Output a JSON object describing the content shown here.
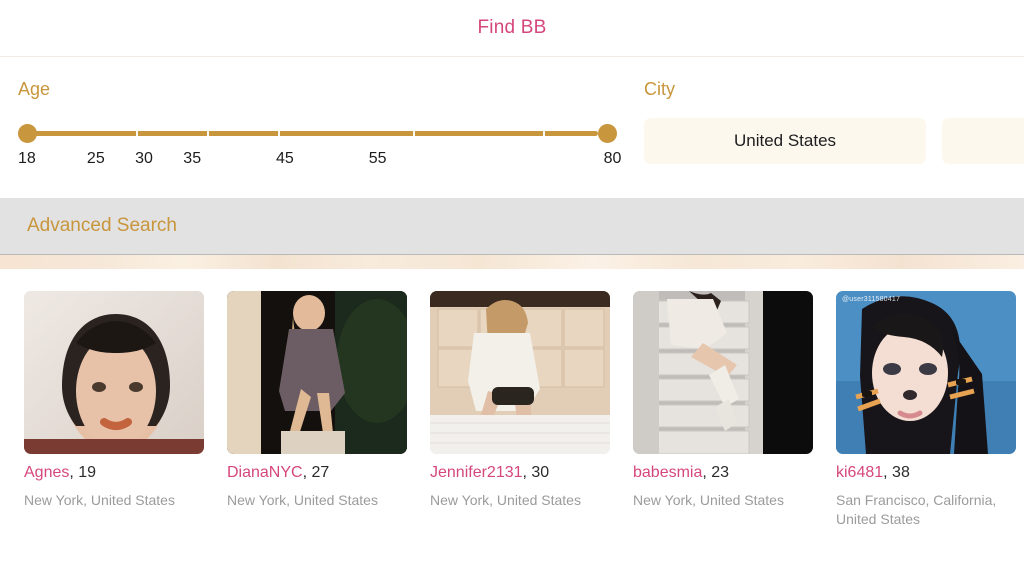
{
  "header": {
    "title": "Find BB"
  },
  "filters": {
    "age": {
      "label": "Age",
      "min_value": "18",
      "max_value": "80",
      "scale_labels": [
        "18",
        "25",
        "30",
        "35",
        "45",
        "55",
        "80"
      ],
      "scale_positions": [
        0,
        11.3,
        19.2,
        27.1,
        42.3,
        57.5,
        96.0
      ],
      "tick_positions": [
        20,
        32,
        44,
        67,
        89
      ]
    },
    "city": {
      "label": "City",
      "country_value": "United States",
      "secondary_value": "",
      "secondary_placeholder": ""
    }
  },
  "advanced_search": {
    "label": "Advanced Search"
  },
  "accent_colors": {
    "pink": "#d5477c",
    "gold": "#c8963c",
    "cream": "#fdf8ee",
    "grey_bar": "#e2e2e2"
  },
  "results": [
    {
      "name": "Agnes",
      "age": "19",
      "separator": ", ",
      "location": "New York, United States",
      "watermark": ""
    },
    {
      "name": "DianaNYC",
      "age": "27",
      "separator": ", ",
      "location": "New York, United States",
      "watermark": ""
    },
    {
      "name": "Jennifer2131",
      "age": "30",
      "separator": ", ",
      "location": "New York, United States",
      "watermark": ""
    },
    {
      "name": "babesmia",
      "age": "23",
      "separator": ", ",
      "location": "New York, United States",
      "watermark": ""
    },
    {
      "name": "ki6481",
      "age": "38",
      "separator": ", ",
      "location": "San Francisco, California, United States",
      "watermark": "@user311580417"
    }
  ]
}
